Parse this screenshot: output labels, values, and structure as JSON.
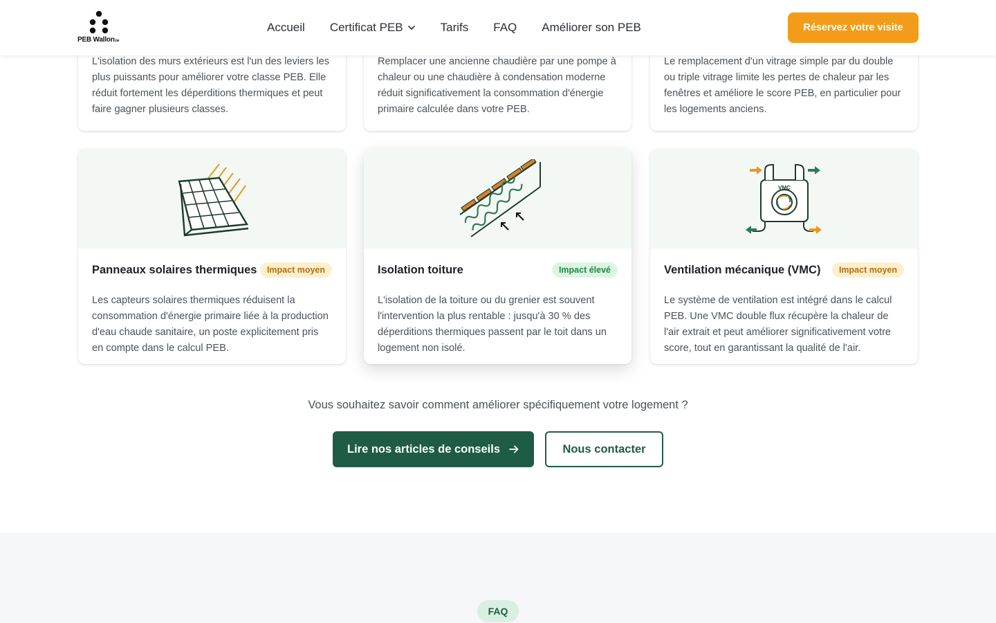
{
  "header": {
    "logo_text": "PEB Wallon",
    "logo_suffix": ".be",
    "nav": [
      {
        "label": "Accueil"
      },
      {
        "label": "Certificat PEB"
      },
      {
        "label": "Tarifs"
      },
      {
        "label": "FAQ"
      },
      {
        "label": "Améliorer son PEB"
      }
    ],
    "cta_label": "Réservez votre visite"
  },
  "top_cards": [
    {
      "desc": "L'isolation des murs extérieurs est l'un des leviers les plus puissants pour améliorer votre classe PEB. Elle réduit fortement les déperditions thermiques et peut faire gagner plusieurs classes."
    },
    {
      "desc": "Remplacer une ancienne chaudière par une pompe à chaleur ou une chaudière à condensation moderne réduit significativement la consommation d'énergie primaire calculée dans votre PEB."
    },
    {
      "desc": "Le remplacement d'un vitrage simple par du double ou triple vitrage limite les pertes de chaleur par les fenêtres et améliore le score PEB, en particulier pour les logements anciens."
    }
  ],
  "cards": [
    {
      "icon": "solar-panel-icon",
      "title": "Panneaux solaires thermiques",
      "badge": "Impact moyen",
      "desc": "Les capteurs solaires thermiques réduisent la consommation d'énergie primaire liée à la production d'eau chaude sanitaire, un poste explicitement pris en compte dans le calcul PEB."
    },
    {
      "icon": "roof-insulation-icon",
      "title": "Isolation toiture",
      "badge": "Impact élevé",
      "desc": "L'isolation de la toiture ou du grenier est souvent l'intervention la plus rentable : jusqu'à 30 % des déperditions thermiques passent par le toit dans un logement non isolé."
    },
    {
      "icon": "ventilation-icon",
      "title": "Ventilation mécanique (VMC)",
      "badge": "Impact moyen",
      "desc": "Le système de ventilation est intégré dans le calcul PEB. Une VMC double flux récupère la chaleur de l'air extrait et peut améliorer significativement votre score, tout en garantissant la qualité de l'air.",
      "icon_label": "VMC"
    }
  ],
  "cta_section": {
    "question": "Vous souhaitez savoir comment améliorer spécifiquement votre logement ?",
    "primary_label": "Lire nos articles de conseils",
    "secondary_label": "Nous contacter"
  },
  "faq_section": {
    "pill": "FAQ"
  },
  "colors": {
    "accent": "#f39c1a",
    "brand": "#1f5c45",
    "badge_moyen": "#fdf0cf",
    "badge_eleve": "#def5e3"
  }
}
